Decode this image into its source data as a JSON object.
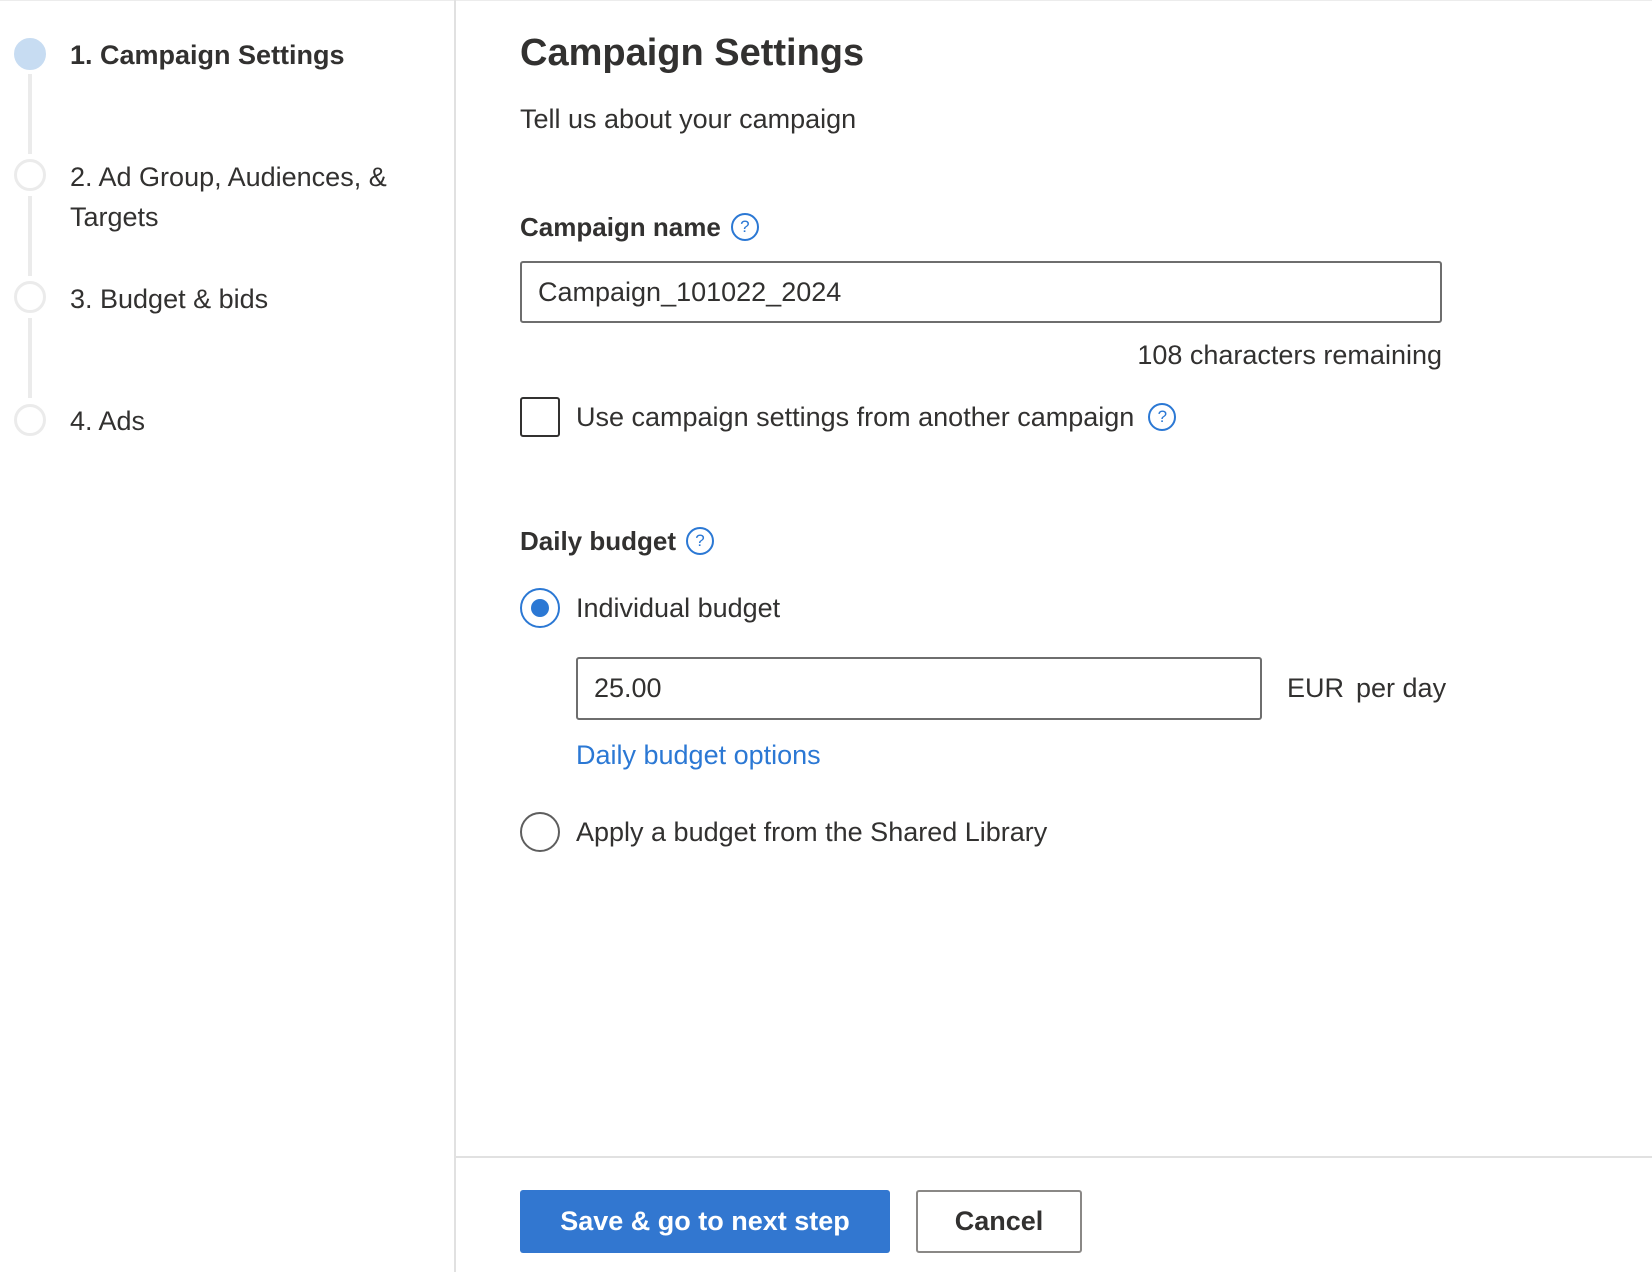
{
  "wizard": {
    "steps": [
      {
        "label": "1. Campaign Settings",
        "state": "active"
      },
      {
        "label_line1": "2. Ad Group, Audiences, &",
        "label_line2": "Targets",
        "state": "pending"
      },
      {
        "label": "3. Budget & bids",
        "state": "pending"
      },
      {
        "label": "4. Ads",
        "state": "pending"
      }
    ]
  },
  "page": {
    "title": "Campaign Settings",
    "subtitle": "Tell us about your campaign"
  },
  "campaign_name": {
    "label": "Campaign name",
    "help_icon": "question-circle-icon",
    "help_glyph": "?",
    "value": "Campaign_101022_2024",
    "remaining_text": "108 characters remaining"
  },
  "copy_settings": {
    "label": "Use campaign settings from another campaign",
    "checked": false,
    "help_glyph": "?"
  },
  "daily_budget": {
    "label": "Daily budget",
    "help_glyph": "?",
    "options": [
      {
        "label": "Individual budget",
        "selected": true
      },
      {
        "label": "Apply a budget from the Shared Library",
        "selected": false
      }
    ],
    "amount": "25.00",
    "currency": "EUR",
    "period": "per day",
    "options_link": "Daily budget options"
  },
  "footer": {
    "save_label": "Save & go to next step",
    "cancel_label": "Cancel"
  },
  "colors": {
    "accent": "#2b78d4",
    "primary_button": "#3277d0",
    "active_step": "#c7dcf2",
    "text": "#323130",
    "divider": "#e1e1e1"
  }
}
